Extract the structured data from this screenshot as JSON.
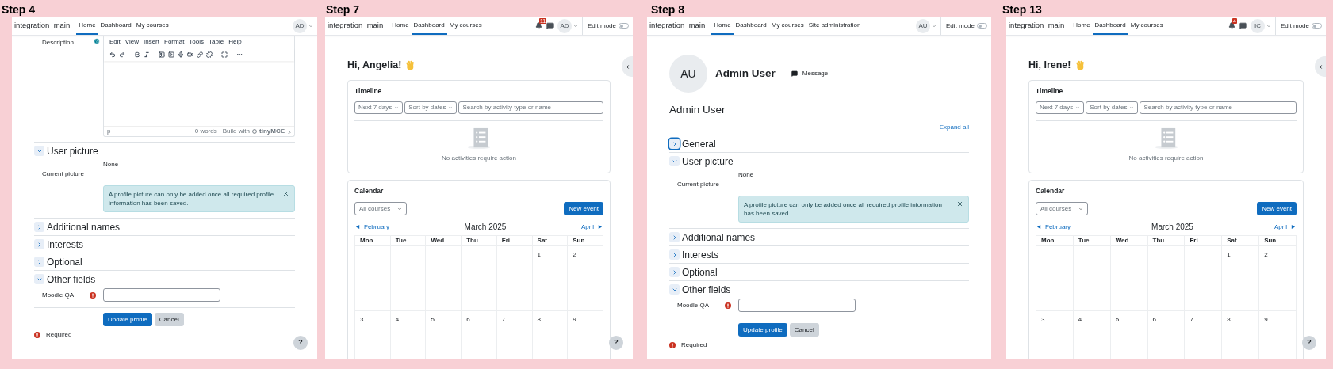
{
  "panels": [
    {
      "kind": "profile",
      "step": "Step 4",
      "nav": {
        "brand": "integration_main",
        "links": [
          {
            "label": "Home",
            "selected": true
          },
          {
            "label": "Dashboard",
            "selected": false
          },
          {
            "label": "My courses",
            "selected": false
          }
        ],
        "avatar": "AD"
      },
      "editor": {
        "label": "Description",
        "menu": [
          "Edit",
          "View",
          "Insert",
          "Format",
          "Tools",
          "Table",
          "Help"
        ],
        "path": "p",
        "word_count": "0 words",
        "branding": "Build with",
        "brand": "tinyMCE"
      },
      "sections": [
        {
          "title": "User picture",
          "expanded": true,
          "focused": false,
          "rows": [
            {
              "kind": "static",
              "label": "Current picture",
              "value": "None"
            },
            {
              "kind": "alert",
              "text": "A profile picture can only be added once all required profile information has been saved."
            }
          ]
        },
        {
          "title": "Additional names",
          "expanded": false,
          "focused": false
        },
        {
          "title": "Interests",
          "expanded": false,
          "focused": false
        },
        {
          "title": "Optional",
          "expanded": false,
          "focused": false
        },
        {
          "title": "Other fields",
          "expanded": true,
          "focused": false,
          "rows": [
            {
              "kind": "input",
              "label": "Moodle QA",
              "required": true
            }
          ]
        }
      ],
      "buttons": [
        {
          "label": "Update profile",
          "kind": "primary"
        },
        {
          "label": "Cancel",
          "kind": "secondary"
        }
      ],
      "required_legend": "Required",
      "help": "?"
    },
    {
      "kind": "dashboard",
      "step": "Step 7",
      "nav": {
        "brand": "integration_main",
        "links": [
          {
            "label": "Home",
            "selected": false
          },
          {
            "label": "Dashboard",
            "selected": true
          },
          {
            "label": "My courses",
            "selected": false
          }
        ],
        "notifications": "11",
        "message_icon": true,
        "avatar": "AD",
        "edit_mode": {
          "label": "Edit mode",
          "on": false
        }
      },
      "greeting": "Hi, Angelia!",
      "timeline": {
        "title": "Timeline",
        "filters": [
          "Next 7 days",
          "Sort by dates"
        ],
        "search": {
          "placeholder": "Search by activity type or name"
        },
        "empty": "No activities require action"
      },
      "calendar": {
        "title": "Calendar",
        "course_filter": "All courses",
        "new_event": "New event",
        "prev": "February",
        "month": "March 2025",
        "next": "April",
        "days": [
          "Mon",
          "Tue",
          "Wed",
          "Thu",
          "Fri",
          "Sat",
          "Sun"
        ],
        "weeks": [
          [
            {
              "kind": "blank"
            },
            {
              "kind": "blank"
            },
            {
              "kind": "blank"
            },
            {
              "kind": "blank"
            },
            {
              "kind": "blank"
            },
            {
              "kind": "day",
              "label": "1"
            },
            {
              "kind": "day",
              "label": "2"
            }
          ],
          [
            {
              "kind": "day",
              "label": "3"
            },
            {
              "kind": "day",
              "label": "4"
            },
            {
              "kind": "day",
              "label": "5"
            },
            {
              "kind": "day",
              "label": "6"
            },
            {
              "kind": "day",
              "label": "7"
            },
            {
              "kind": "day",
              "label": "8"
            },
            {
              "kind": "day",
              "label": "9"
            }
          ]
        ]
      },
      "help": "?"
    },
    {
      "kind": "profile",
      "step": "Step 8",
      "nav": {
        "brand": "integration_main",
        "links": [
          {
            "label": "Home",
            "selected": true
          },
          {
            "label": "Dashboard",
            "selected": false
          },
          {
            "label": "My courses",
            "selected": false
          },
          {
            "label": "Site administration",
            "selected": false
          }
        ],
        "avatar": "AU",
        "edit_mode": {
          "label": "Edit mode",
          "on": false
        }
      },
      "header": {
        "avatar": "AU",
        "name": "Admin User",
        "message": "Message"
      },
      "heading": "Admin User",
      "expand_all": "Expand all",
      "sections": [
        {
          "title": "General",
          "expanded": false,
          "focused": true
        },
        {
          "title": "User picture",
          "expanded": true,
          "focused": false,
          "rows": [
            {
              "kind": "static",
              "label": "Current picture",
              "value": "None"
            },
            {
              "kind": "alert",
              "text": "A profile picture can only be added once all required profile information has been saved."
            }
          ]
        },
        {
          "title": "Additional names",
          "expanded": false,
          "focused": false
        },
        {
          "title": "Interests",
          "expanded": false,
          "focused": false
        },
        {
          "title": "Optional",
          "expanded": false,
          "focused": false
        },
        {
          "title": "Other fields",
          "expanded": true,
          "focused": false,
          "rows": [
            {
              "kind": "input",
              "label": "Moodle QA",
              "required": true
            }
          ]
        }
      ],
      "buttons": [
        {
          "label": "Update profile",
          "kind": "primary"
        },
        {
          "label": "Cancel",
          "kind": "secondary"
        }
      ],
      "required_legend": "Required"
    },
    {
      "kind": "dashboard",
      "step": "Step 13",
      "nav": {
        "brand": "integration_main",
        "links": [
          {
            "label": "Home",
            "selected": false
          },
          {
            "label": "Dashboard",
            "selected": true
          },
          {
            "label": "My courses",
            "selected": false
          }
        ],
        "notifications": "4",
        "message_icon": true,
        "avatar": "IC",
        "edit_mode": {
          "label": "Edit mode",
          "on": false
        }
      },
      "greeting": "Hi, Irene!",
      "timeline": {
        "title": "Timeline",
        "filters": [
          "Next 7 days",
          "Sort by dates"
        ],
        "search": {
          "placeholder": "Search by activity type or name"
        },
        "empty": "No activities require action"
      },
      "calendar": {
        "title": "Calendar",
        "course_filter": "All courses",
        "new_event": "New event",
        "prev": "February",
        "month": "March 2025",
        "next": "April",
        "days": [
          "Mon",
          "Tue",
          "Wed",
          "Thu",
          "Fri",
          "Sat",
          "Sun"
        ],
        "weeks": [
          [
            {
              "kind": "blank"
            },
            {
              "kind": "blank"
            },
            {
              "kind": "blank"
            },
            {
              "kind": "blank"
            },
            {
              "kind": "blank"
            },
            {
              "kind": "day",
              "label": "1"
            },
            {
              "kind": "day",
              "label": "2"
            }
          ],
          [
            {
              "kind": "day",
              "label": "3"
            },
            {
              "kind": "day",
              "label": "4"
            },
            {
              "kind": "day",
              "label": "5"
            },
            {
              "kind": "day",
              "label": "6"
            },
            {
              "kind": "day",
              "label": "7"
            },
            {
              "kind": "day",
              "label": "8"
            },
            {
              "kind": "day",
              "label": "9"
            }
          ]
        ]
      },
      "help": "?"
    }
  ]
}
